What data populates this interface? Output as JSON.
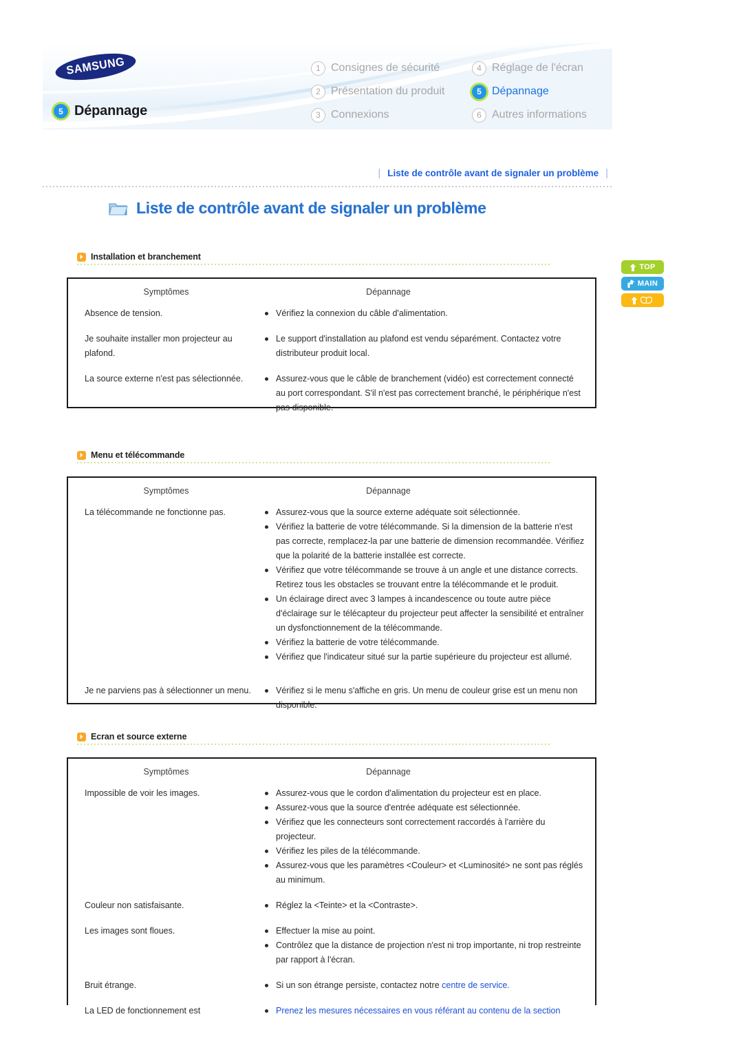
{
  "header": {
    "brand": "SAMSUNG",
    "current_section": {
      "number": "5",
      "label": "Dépannage"
    },
    "nav": [
      {
        "number": "1",
        "label": "Consignes de sécurité",
        "active": false
      },
      {
        "number": "4",
        "label": "Réglage de l'écran",
        "active": false
      },
      {
        "number": "2",
        "label": "Présentation du produit",
        "active": false
      },
      {
        "number": "5",
        "label": "Dépannage",
        "active": true
      },
      {
        "number": "3",
        "label": "Connexions",
        "active": false
      },
      {
        "number": "6",
        "label": "Autres informations",
        "active": false
      }
    ]
  },
  "breadcrumb": {
    "separator": "|",
    "text": "Liste de contrôle avant de signaler un problème"
  },
  "page_title": "Liste de contrôle avant de signaler un problème",
  "side_buttons": [
    {
      "name": "top",
      "label": "TOP",
      "color": "#a3d02b"
    },
    {
      "name": "main",
      "label": "MAIN",
      "color": "#36a9e1"
    },
    {
      "name": "manual",
      "label": "",
      "color": "#fcb813"
    }
  ],
  "columns": {
    "symptoms": "Symptômes",
    "troubleshooting": "Dépannage"
  },
  "sections": [
    {
      "title": "Installation et branchement",
      "rows": [
        {
          "symptom": "Absence de tension.",
          "items": [
            {
              "text": "Vérifiez la connexion du câble d'alimentation."
            }
          ]
        },
        {
          "symptom": "Je souhaite installer mon projecteur au plafond.",
          "items": [
            {
              "text": "Le support d'installation au plafond est vendu séparément. Contactez votre distributeur produit local."
            }
          ]
        },
        {
          "symptom": "La source externe n'est pas sélectionnée.",
          "items": [
            {
              "text": "Assurez-vous que le câble de branchement (vidéo) est correctement connecté au port correspondant. S'il n'est pas correctement branché, le périphérique n'est pas disponible."
            }
          ]
        }
      ]
    },
    {
      "title": "Menu et télécommande",
      "rows": [
        {
          "symptom": "La télécommande ne fonctionne pas.",
          "items": [
            {
              "text": "Assurez-vous que la source externe adéquate soit sélectionnée."
            },
            {
              "text": "Vérifiez la batterie de votre télécommande. Si la dimension de la batterie n'est pas correcte, remplacez-la par une batterie de dimension recommandée. Vérifiez que la polarité de la batterie installée est correcte."
            },
            {
              "text": "Vérifiez que votre télécommande se trouve à un angle et une distance corrects. Retirez tous les obstacles se trouvant entre la télécommande et le produit."
            },
            {
              "text": "Un éclairage direct avec 3 lampes à incandescence ou toute autre pièce d'éclairage sur le télécapteur du projecteur peut affecter la sensibilité et entraîner un dysfonctionnement de la télécommande."
            },
            {
              "text": "Vérifiez la batterie de votre télécommande."
            },
            {
              "text": "Vérifiez que l'indicateur situé sur la partie supérieure du projecteur est allumé."
            }
          ]
        },
        {
          "symptom": "Je ne parviens pas à sélectionner un menu.",
          "items": [
            {
              "text": "Vérifiez si le menu s'affiche en gris. Un menu de couleur grise est un menu non disponible."
            }
          ]
        }
      ]
    },
    {
      "title": "Ecran et source externe",
      "rows": [
        {
          "symptom": "Impossible de voir les images.",
          "items": [
            {
              "text": "Assurez-vous que le cordon d'alimentation du projecteur est en place."
            },
            {
              "text": "Assurez-vous que la source d'entrée adéquate est sélectionnée."
            },
            {
              "text": "Vérifiez que les connecteurs sont correctement raccordés à l'arrière du projecteur."
            },
            {
              "text": "Vérifiez les piles de la télécommande."
            },
            {
              "text": "Assurez-vous que les paramètres <Couleur> et <Luminosité> ne sont pas réglés au minimum."
            }
          ]
        },
        {
          "symptom": "Couleur non satisfaisante.",
          "items": [
            {
              "text": "Réglez la <Teinte> et la <Contraste>."
            }
          ]
        },
        {
          "symptom": "Les images sont floues.",
          "items": [
            {
              "text": "Effectuer la mise au point."
            },
            {
              "text": "Contrôlez que la distance de projection n'est ni trop importante, ni trop restreinte par rapport à l'écran."
            }
          ]
        },
        {
          "symptom": "Bruit étrange.",
          "items": [
            {
              "text": "Si un son étrange persiste, contactez notre ",
              "link_text": "centre de service.",
              "has_link": true
            }
          ]
        },
        {
          "symptom": "La LED de fonctionnement est",
          "items": [
            {
              "text": "Prenez les mesures nécessaires en vous référant au contenu de la section",
              "is_link": true
            }
          ]
        }
      ]
    }
  ]
}
